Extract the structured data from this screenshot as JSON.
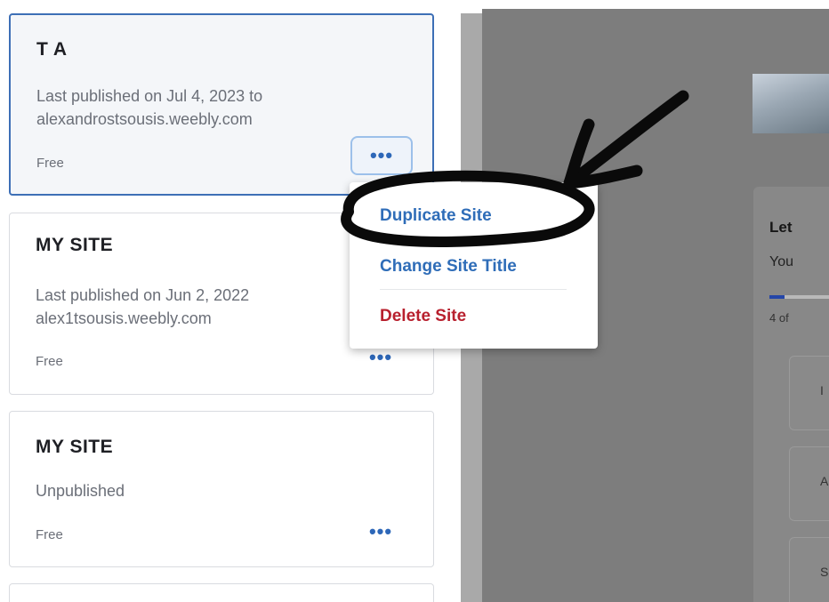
{
  "sites": [
    {
      "title": "T A",
      "status": "Last published on Jul 4, 2023 to",
      "domain": "alexandrostsousis.weebly.com",
      "plan": "Free",
      "more_label": "•••",
      "selected": true
    },
    {
      "title": "MY SITE",
      "status": "Last published on Jun 2, 2022",
      "domain": "alex1tsousis.weebly.com",
      "plan": "Free",
      "more_label": "•••"
    },
    {
      "title": "MY SITE",
      "status": "Unpublished",
      "plan": "Free",
      "more_label": "•••"
    }
  ],
  "site_menu": {
    "duplicate": "Duplicate Site",
    "change_title": "Change Site Title",
    "delete": "Delete Site"
  },
  "main": {
    "panel_heading": "Let",
    "panel_sub": "You",
    "progress_count": "4 of",
    "progress_fraction": 0.25,
    "task_letters": [
      "I",
      "A",
      "S"
    ]
  },
  "colors": {
    "accent": "#2f6db8",
    "danger": "#b8202e",
    "selected_border": "#3d6fb6",
    "overlay": "#7d7d7d"
  }
}
